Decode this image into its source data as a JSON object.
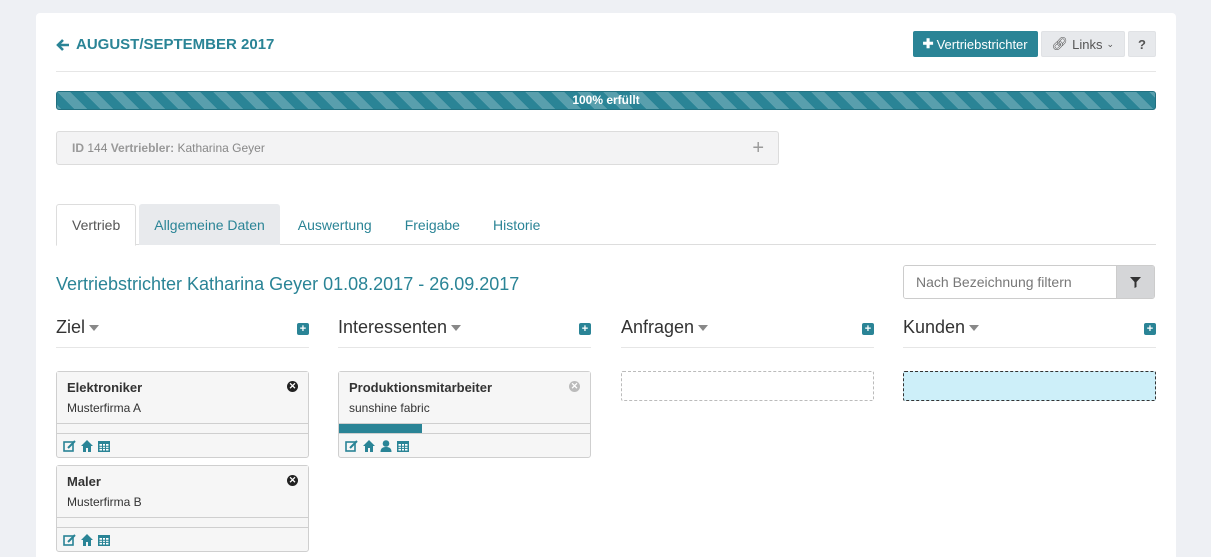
{
  "header": {
    "title": "AUGUST/SEPTEMBER 2017",
    "btn_add": "Vertriebstrichter",
    "btn_links": "Links",
    "btn_help": "?"
  },
  "progress": {
    "label": "100% erfüllt",
    "value": 1.0
  },
  "idbox": {
    "id_label": "ID",
    "id_value": "144",
    "seller_label": "Vertriebler:",
    "seller_name": "Katharina Geyer"
  },
  "tabs": [
    "Vertrieb",
    "Allgemeine Daten",
    "Auswertung",
    "Freigabe",
    "Historie"
  ],
  "funnel_title": "Vertriebstrichter Katharina Geyer 01.08.2017 - 26.09.2017",
  "filter": {
    "placeholder": "Nach Bezeichnung filtern"
  },
  "columns": [
    {
      "title": "Ziel",
      "cards": [
        {
          "title": "Elektroniker",
          "company": "Musterfirma A"
        },
        {
          "title": "Maler",
          "company": "Musterfirma B"
        }
      ]
    },
    {
      "title": "Interessenten",
      "cards": [
        {
          "title": "Produktionsmitarbeiter",
          "company": "sunshine fabric",
          "progress": 0.33
        }
      ]
    },
    {
      "title": "Anfragen",
      "cards": []
    },
    {
      "title": "Kunden",
      "cards": []
    }
  ],
  "colors": {
    "accent": "#2a8496",
    "drop_highlight": "#cdeff9"
  }
}
